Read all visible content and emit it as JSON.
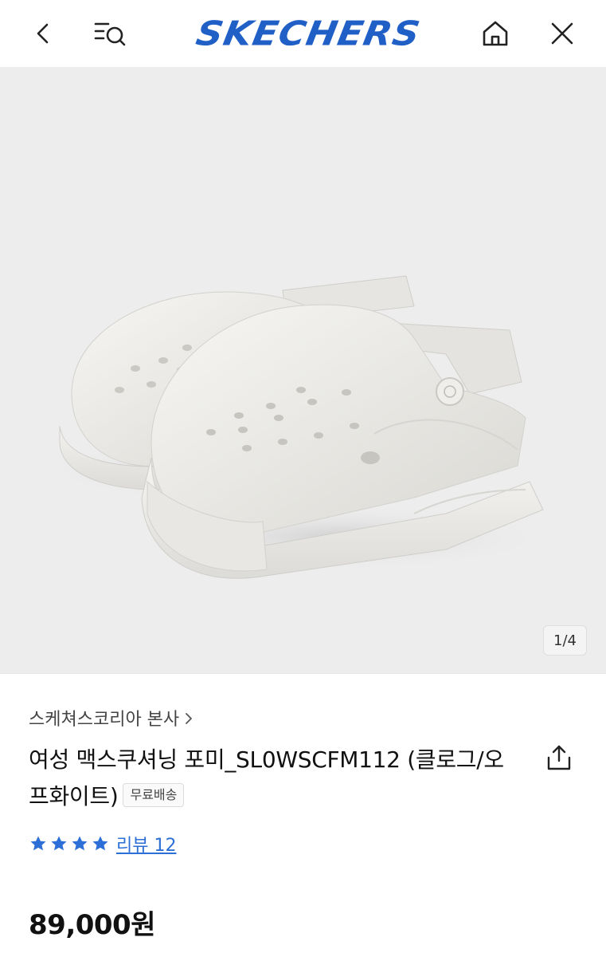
{
  "header": {
    "brand": "SKECHERS",
    "icons": [
      "back-icon",
      "search-list-icon",
      "home-icon",
      "close-icon"
    ]
  },
  "gallery": {
    "pager": "1/4"
  },
  "product": {
    "seller": "스케쳐스코리아 본사",
    "title": "여성 맥스쿠셔닝 포미_SL0WSCFM112 (클로그/오프화이트)",
    "shipping_badge": "무료배송",
    "rating_stars": 4,
    "review_label": "리뷰 12",
    "price": "89,000원"
  },
  "colors": {
    "brand_blue": "#1f5fc6",
    "link_blue": "#2c6fd6",
    "hero_bg": "#ededed"
  }
}
